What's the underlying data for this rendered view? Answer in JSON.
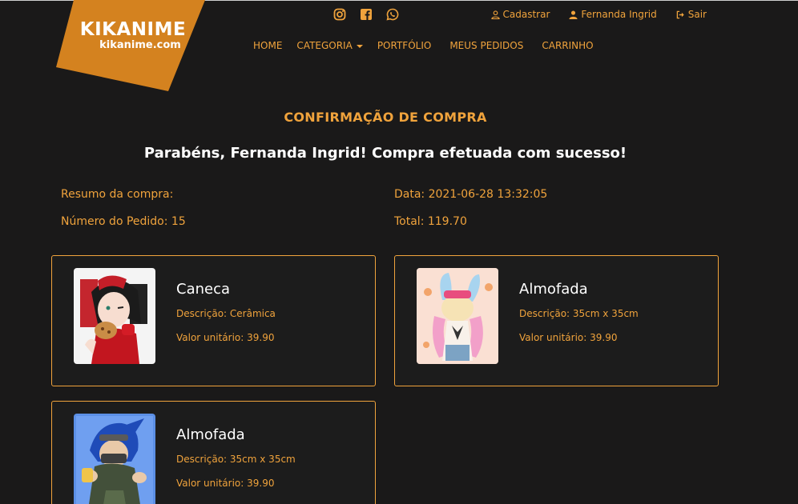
{
  "brand": {
    "name": "KIKANIME",
    "domain": "kikanime.com",
    "color": "#d4821f"
  },
  "social": [
    {
      "icon": "instagram-icon"
    },
    {
      "icon": "facebook-icon"
    },
    {
      "icon": "whatsapp-icon"
    }
  ],
  "userbar": {
    "register_label": "Cadastrar",
    "user_label": "Fernanda Ingrid",
    "logout_label": "Sair"
  },
  "nav": {
    "home": "HOME",
    "category": "CATEGORIA",
    "portfolio": "PORTFÓLIO",
    "orders": "MEUS PEDIDOS",
    "cart": "CARRINHO"
  },
  "page": {
    "title": "CONFIRMAÇÃO DE COMPRA",
    "success_message": "Parabéns, Fernanda Ingrid! Compra efetuada com sucesso!"
  },
  "summary": {
    "summary_label": "Resumo da compra:",
    "order_label": "Número do Pedido: 15",
    "date_label": "Data: 2021-06-28 13:32:05",
    "total_label": "Total: 119.70"
  },
  "products": [
    {
      "name": "Caneca",
      "description": "Descrição: Cerâmica",
      "unit_value": "Valor unitário: 39.90"
    },
    {
      "name": "Almofada",
      "description": "Descrição: 35cm x 35cm",
      "unit_value": "Valor unitário: 39.90"
    },
    {
      "name": "Almofada",
      "description": "Descrição: 35cm x 35cm",
      "unit_value": "Valor unitário: 39.90"
    }
  ],
  "colors": {
    "accent": "#f0a33c",
    "background": "#1a1919",
    "heading_text": "#ffffff"
  }
}
